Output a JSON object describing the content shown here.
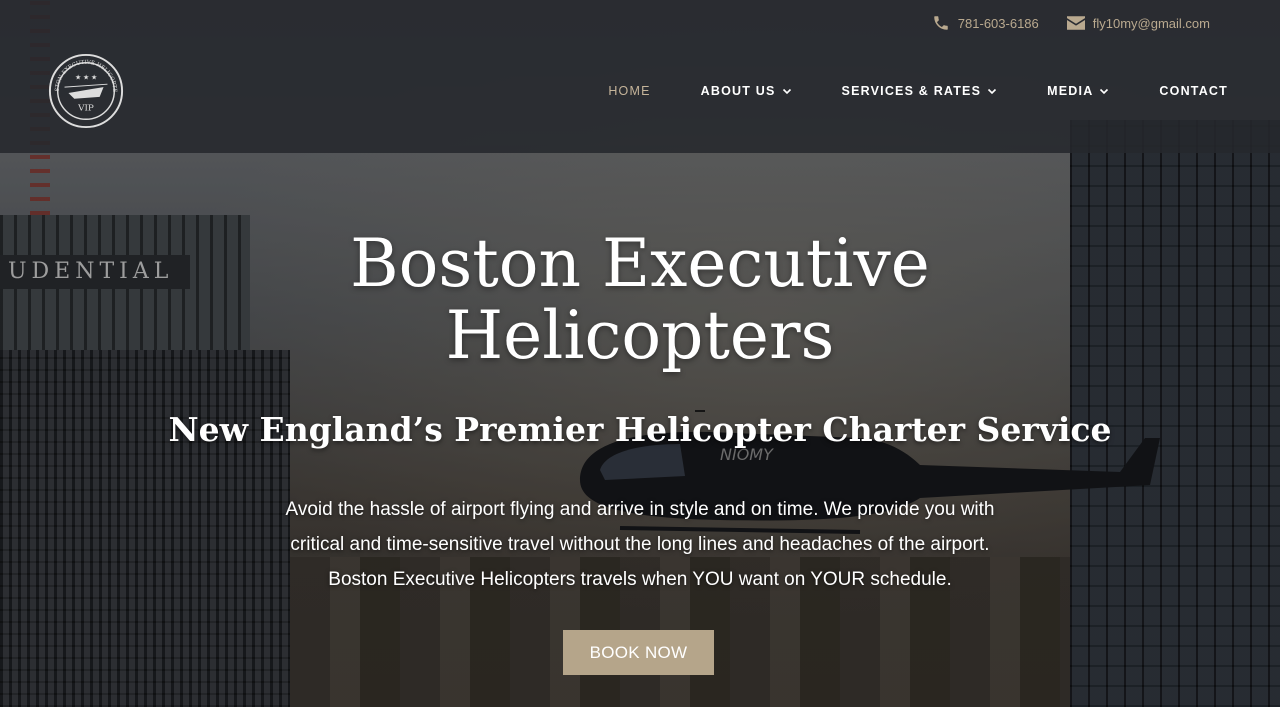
{
  "topbar": {
    "phone": "781-603-6186",
    "email": "fly10my@gmail.com",
    "phone_icon": "phone-icon",
    "email_icon": "envelope-icon"
  },
  "logo": {
    "arc_text": "BOSTON EXECUTIVE HELICOPTERS",
    "badge_text": "VIP"
  },
  "nav": {
    "items": [
      {
        "label": "HOME",
        "active": true,
        "dropdown": false
      },
      {
        "label": "ABOUT US",
        "active": false,
        "dropdown": true
      },
      {
        "label": "SERVICES & RATES",
        "active": false,
        "dropdown": true
      },
      {
        "label": "MEDIA",
        "active": false,
        "dropdown": true
      },
      {
        "label": "CONTACT",
        "active": false,
        "dropdown": false
      }
    ]
  },
  "hero": {
    "title_line1": "Boston Executive",
    "title_line2": "Helicopters",
    "subtitle": "New England’s Premier Helicopter Charter Service",
    "desc_line1": "Avoid the hassle of airport flying and arrive in style and on time. We provide you with",
    "desc_line2": "critical and time-sensitive travel without the long lines and headaches of the airport.",
    "desc_line3": "Boston Executive Helicopters travels when YOU want on YOUR schedule.",
    "cta_label": "BOOK NOW",
    "background_sign": "UDENTIAL",
    "heli_tail_text": "NIOMY"
  },
  "colors": {
    "accent": "#b5a58a",
    "nav_active": "#c5b49a",
    "header_bg": "#26282c"
  }
}
